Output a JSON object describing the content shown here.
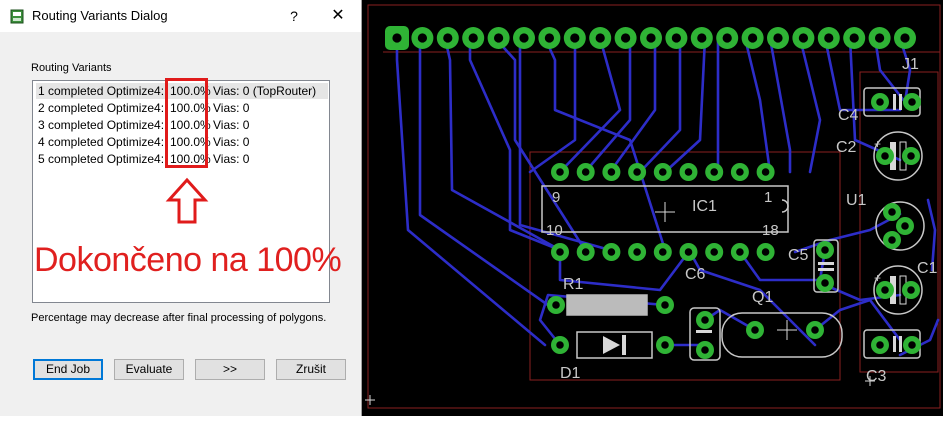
{
  "dialog": {
    "title": "Routing Variants Dialog",
    "help": "?",
    "close": "✕",
    "group_label": "Routing Variants",
    "rows": [
      {
        "name": "1 completed Optimize4:",
        "percent": "100.0%",
        "vias": "Vias: 0 (TopRouter)"
      },
      {
        "name": "2 completed Optimize4:",
        "percent": "100.0%",
        "vias": "Vias: 0"
      },
      {
        "name": "3 completed Optimize4:",
        "percent": "100.0%",
        "vias": "Vias: 0"
      },
      {
        "name": "4 completed Optimize4:",
        "percent": "100.0%",
        "vias": "Vias: 0"
      },
      {
        "name": "5 completed Optimize4:",
        "percent": "100.0%",
        "vias": "Vias: 0"
      }
    ],
    "note": "Percentage may decrease after final processing of polygons.",
    "buttons": {
      "end_job": "End Job",
      "evaluate": "Evaluate",
      "next": ">>",
      "cancel": "Zrušit"
    }
  },
  "annotation": {
    "text": "Dokončeno na 100%",
    "color": "#e0201f"
  },
  "board": {
    "labels": {
      "ic1": "IC1",
      "pin9": "9",
      "pin1": "1",
      "pin10": "10",
      "pin18": "18",
      "j1": "J1",
      "c4": "C4",
      "c2": "C2",
      "u1": "U1",
      "c1": "C1",
      "c5": "C5",
      "c6": "C6",
      "r1": "R1",
      "q1": "Q1",
      "d1": "D1",
      "c3": "C3"
    },
    "colors": {
      "trace": "#2d2dc8",
      "pad": "#2fb335",
      "silk": "#c8c8c8",
      "outline": "#8a2020"
    }
  }
}
